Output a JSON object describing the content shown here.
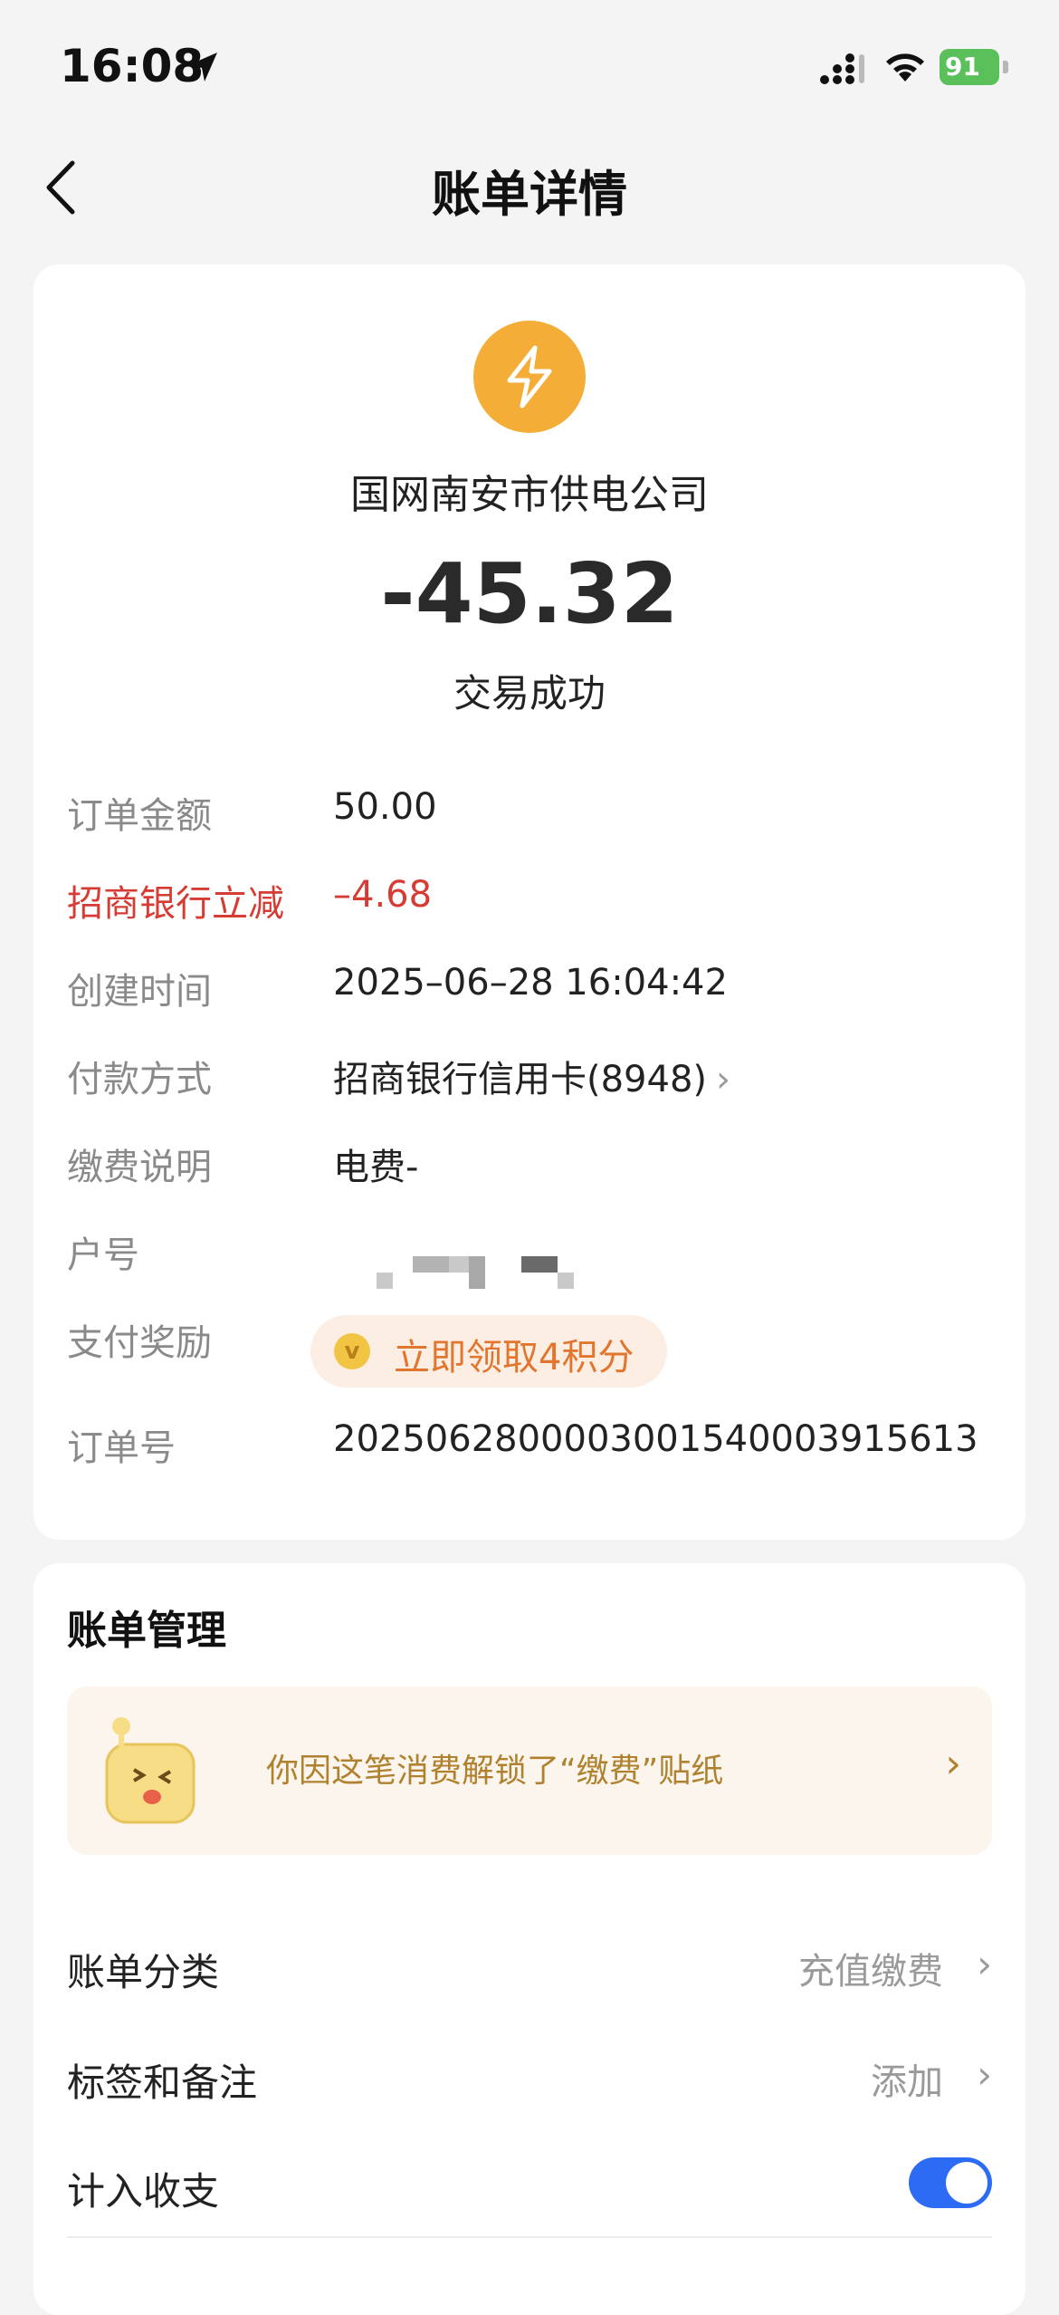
{
  "status_bar": {
    "time": "16:08",
    "battery": "91"
  },
  "nav": {
    "title": "账单详情"
  },
  "summary": {
    "merchant": "国网南安市供电公司",
    "amount": "-45.32",
    "status": "交易成功"
  },
  "details": [
    {
      "label": "订单金额",
      "value": "50.00"
    },
    {
      "label": "招商银行立减",
      "value": "–4.68"
    },
    {
      "label": "创建时间",
      "value": "2025–06–28 16:04:42"
    },
    {
      "label": "付款方式",
      "value": "招商银行信用卡(8948)"
    },
    {
      "label": "缴费说明",
      "value": "电费-"
    },
    {
      "label": "户号",
      "value": ""
    },
    {
      "label": "支付奖励",
      "value": "立即领取4积分"
    },
    {
      "label": "订单号",
      "value": "2025062800003001540003915613"
    }
  ],
  "management": {
    "title": "账单管理",
    "sticker_text": "你因这笔消费解锁了“缴费”贴纸",
    "category_label": "账单分类",
    "category_value": "充值缴费",
    "tags_label": "标签和备注",
    "tags_value": "添加",
    "include_label": "计入收支",
    "include_on": true
  },
  "colors": {
    "accent_blue": "#2c6cf5",
    "discount_red": "#d63b34",
    "merchant_icon": "#f4ae38",
    "reward_orange": "#e2762f"
  },
  "icons": [
    "location-arrow-icon",
    "signal-icon",
    "wifi-icon",
    "battery-icon",
    "back-chevron-icon",
    "lightning-icon",
    "coin-icon",
    "chevron-right-icon"
  ]
}
